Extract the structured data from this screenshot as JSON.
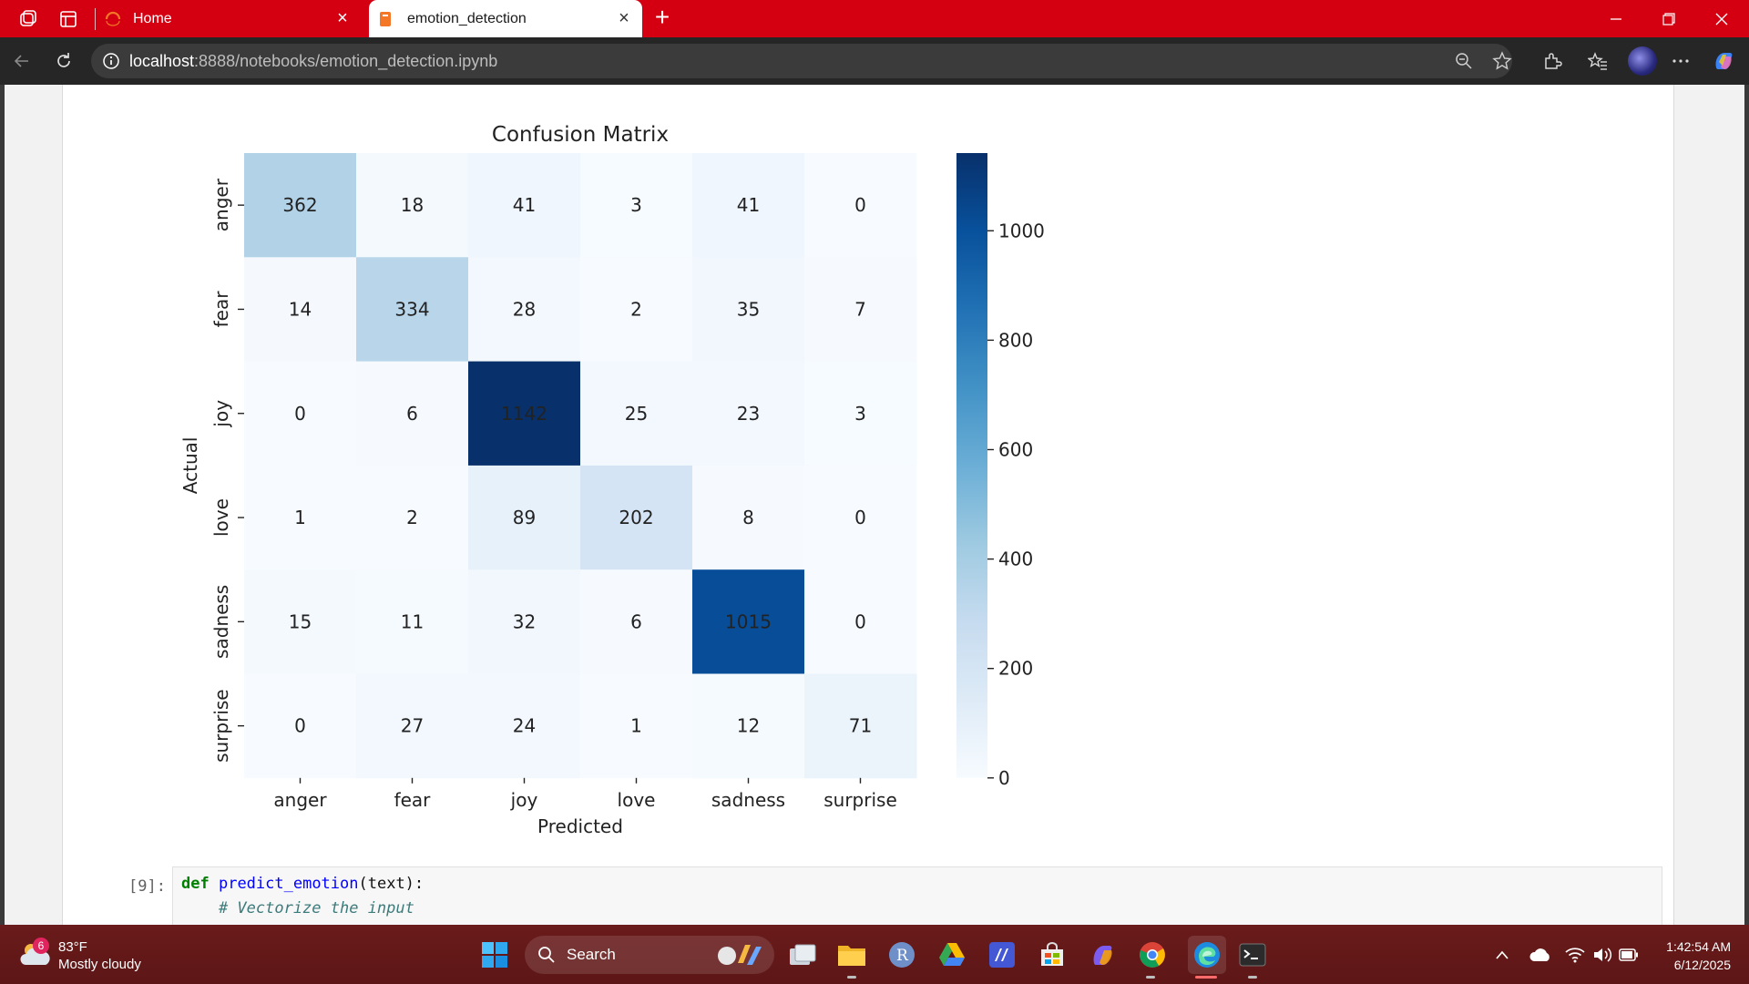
{
  "browser": {
    "tabs": [
      {
        "label": "Home"
      },
      {
        "label": "emotion_detection"
      }
    ],
    "url_host": "localhost",
    "url_rest": ":8888/notebooks/emotion_detection.ipynb"
  },
  "chart_data": {
    "type": "heatmap",
    "title": "Confusion Matrix",
    "xlabel": "Predicted",
    "ylabel": "Actual",
    "x_categories": [
      "anger",
      "fear",
      "joy",
      "love",
      "sadness",
      "surprise"
    ],
    "y_categories": [
      "anger",
      "fear",
      "joy",
      "love",
      "sadness",
      "surprise"
    ],
    "values": [
      [
        362,
        18,
        41,
        3,
        41,
        0
      ],
      [
        14,
        334,
        28,
        2,
        35,
        7
      ],
      [
        0,
        6,
        1142,
        25,
        23,
        3
      ],
      [
        1,
        2,
        89,
        202,
        8,
        0
      ],
      [
        15,
        11,
        32,
        6,
        1015,
        0
      ],
      [
        0,
        27,
        24,
        1,
        12,
        71
      ]
    ],
    "colorbar_ticks": [
      "0",
      "200",
      "400",
      "600",
      "800",
      "1000"
    ],
    "colorbar_range": [
      0,
      1142
    ],
    "colormap": "Blues"
  },
  "code_cell": {
    "prompt": "[9]:",
    "line1_kw": "def",
    "line1_fn": "predict_emotion",
    "line1_rest": "(text):",
    "line2_comment": "    # Vectorize the input"
  },
  "taskbar": {
    "weather_badge": "6",
    "weather_temp": "83°F",
    "weather_desc": "Mostly cloudy",
    "search_label": "Search",
    "time": "1:42:54 AM",
    "date": "6/12/2025"
  },
  "colors": {
    "tab_bar": "#d40012",
    "taskbar": "#6a1b1b"
  }
}
